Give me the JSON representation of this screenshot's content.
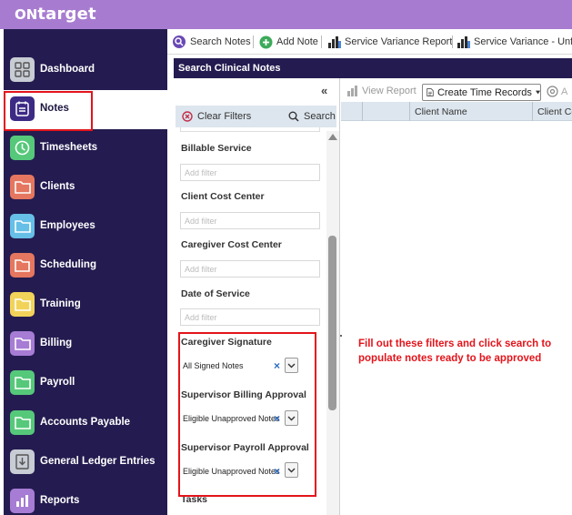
{
  "brand": {
    "prefix": "ON",
    "name": "target"
  },
  "sidebar": {
    "items": [
      {
        "label": "Dashboard",
        "icon": "dashboard-icon",
        "color": "#c8ccd4",
        "active": false
      },
      {
        "label": "Notes",
        "icon": "notes-icon",
        "color": "#3d2a85",
        "active": true
      },
      {
        "label": "Timesheets",
        "icon": "clock-icon",
        "color": "#56c87a",
        "active": false
      },
      {
        "label": "Clients",
        "icon": "folder-icon",
        "color": "#e5765f",
        "active": false
      },
      {
        "label": "Employees",
        "icon": "folder-icon",
        "color": "#66bfe6",
        "active": false
      },
      {
        "label": "Scheduling",
        "icon": "calendar-icon",
        "color": "#e5765f",
        "active": false
      },
      {
        "label": "Training",
        "icon": "folder-icon",
        "color": "#f2d35a",
        "active": false
      },
      {
        "label": "Billing",
        "icon": "folder-icon",
        "color": "#a67cd4",
        "active": false
      },
      {
        "label": "Payroll",
        "icon": "folder-icon",
        "color": "#56c87a",
        "active": false
      },
      {
        "label": "Accounts Payable",
        "icon": "folder-icon",
        "color": "#56c87a",
        "active": false
      },
      {
        "label": "General Ledger Entries",
        "icon": "download-icon",
        "color": "#c8ccd4",
        "active": false
      },
      {
        "label": "Reports",
        "icon": "reports-icon",
        "color": "#a67cd4",
        "active": false
      }
    ]
  },
  "toolbar": {
    "search_notes": "Search Notes",
    "add_note": "Add Note",
    "service_variance_report": "Service Variance Report",
    "service_variance_unf": "Service Variance - Unfi"
  },
  "search_header": "Search Clinical Notes",
  "filters": {
    "clear_label": "Clear Filters",
    "search_label": "Search",
    "fields": [
      {
        "title": "Billable Service",
        "placeholder": "Add filter"
      },
      {
        "title": "Client Cost Center",
        "placeholder": "Add filter"
      },
      {
        "title": "Caregiver Cost Center",
        "placeholder": "Add filter"
      },
      {
        "title": "Date of Service",
        "placeholder": "Add filter"
      }
    ],
    "selects": [
      {
        "title": "Caregiver Signature",
        "value": "All Signed Notes"
      },
      {
        "title": "Supervisor Billing Approval",
        "value": "Eligible Unapproved Notes"
      },
      {
        "title": "Supervisor Payroll Approval",
        "value": "Eligible Unapproved Notes"
      }
    ],
    "tasks_title": "Tasks"
  },
  "results": {
    "view_report": "View Report",
    "create_time_records": "Create Time Records",
    "columns": [
      "Client Name",
      "Client Co"
    ]
  },
  "annotation": "Fill out these filters and click search to populate notes ready to be approved"
}
